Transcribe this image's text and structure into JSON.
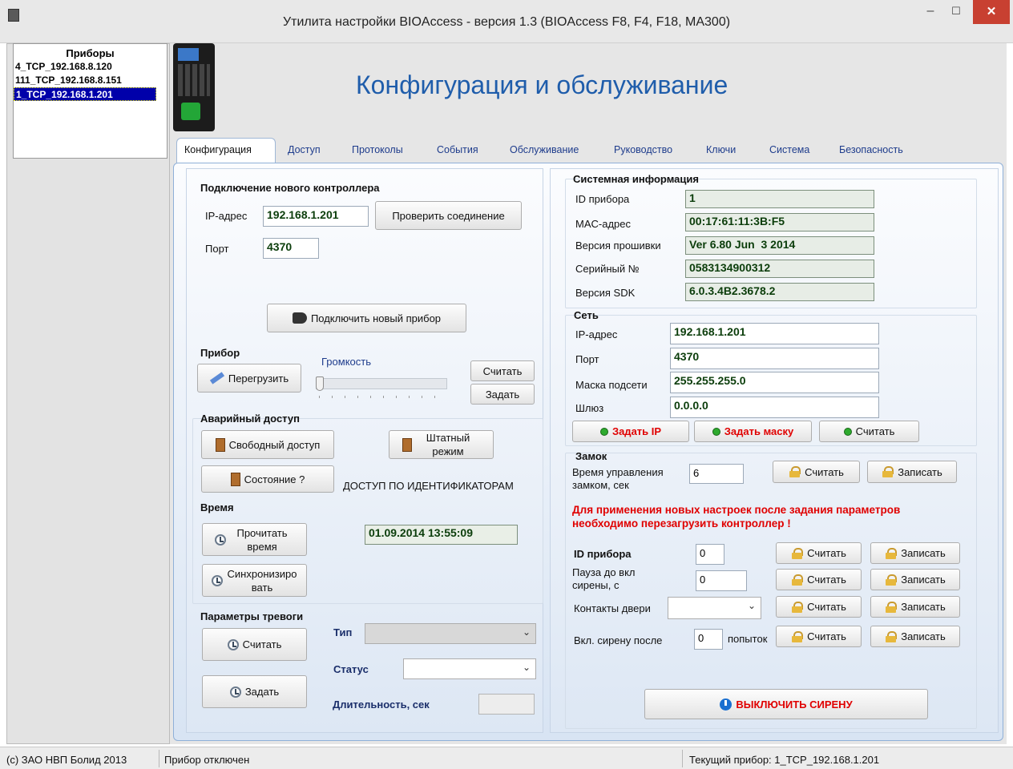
{
  "window": {
    "title": "Утилита настройки BIOAccess - версия 1.3 (BIOAccess F8, F4, F18, MA300)",
    "min": "–",
    "max": "☐",
    "close": "✕"
  },
  "devices": {
    "header": "Приборы",
    "items": [
      "4_TCP_192.168.8.120",
      "111_TCP_192.168.8.151",
      "1_TCP_192.168.1.201"
    ],
    "selected_index": 2
  },
  "heading": "Конфигурация и обслуживание",
  "tabs": [
    "Конфигурация",
    "Доступ",
    "Протоколы",
    "События",
    "Обслуживание",
    "Руководство",
    "Ключи",
    "Система",
    "Безопасность"
  ],
  "new_ctrl": {
    "title": "Подключение нового контроллера",
    "ip_label": "IP-адрес",
    "ip_value": "192.168.1.201",
    "check_btn": "Проверить соединение",
    "port_label": "Порт",
    "port_value": "4370",
    "connect_btn": "Подключить новый прибор"
  },
  "device": {
    "title": "Прибор",
    "reboot_btn": "Перегрузить",
    "volume_label": "Громкость",
    "volume_level": 0,
    "read_btn": "Считать",
    "set_btn": "Задать"
  },
  "emergency": {
    "title": "Аварийный доступ",
    "free_btn": "Свободный доступ",
    "normal_btn": "Штатный режим",
    "state_btn": "Состояние ?",
    "state_text": "ДОСТУП ПО ИДЕНТИФИКАТОРАМ"
  },
  "time": {
    "title": "Время",
    "read_btn": "Прочитать время",
    "sync_btn": "Синхронизировать",
    "value": "01.09.2014 13:55:09"
  },
  "alarm": {
    "title": "Параметры тревоги",
    "read_btn": "Считать",
    "set_btn": "Задать",
    "type_label": "Тип",
    "status_label": "Статус",
    "duration_label": "Длительность, сек"
  },
  "sysinfo": {
    "title": "Системная информация",
    "rows": [
      {
        "label": "ID прибора",
        "value": "1"
      },
      {
        "label": "MAC-адрес",
        "value": "00:17:61:11:3B:F5"
      },
      {
        "label": "Версия прошивки",
        "value": "Ver 6.80 Jun  3 2014"
      },
      {
        "label": "Серийный №",
        "value": "0583134900312"
      },
      {
        "label": "Версия SDK",
        "value": "6.0.3.4B2.3678.2"
      }
    ]
  },
  "network": {
    "title": "Сеть",
    "rows": [
      {
        "label": "IP-адрес",
        "value": "192.168.1.201"
      },
      {
        "label": "Порт",
        "value": "4370"
      },
      {
        "label": "Маска подсети",
        "value": "255.255.255.0"
      },
      {
        "label": "Шлюз",
        "value": "0.0.0.0"
      }
    ],
    "set_ip_btn": "Задать IP",
    "set_mask_btn": "Задать маску",
    "read_btn": "Считать"
  },
  "lock": {
    "title": "Замок",
    "time_label": "Время управления замком,  сек",
    "time_value": "6",
    "read_btn": "Считать",
    "write_btn": "Записать"
  },
  "warning": "Для применения новых настроек после задания параметров необходимо перезагрузить контроллер !",
  "params": {
    "id_label": "ID прибора",
    "id_value": "0",
    "pause_label": "Пауза до вкл сирены, с",
    "pause_value": "0",
    "door_label": "Контакты двери",
    "siren_label": "Вкл. сирену после",
    "siren_value": "0",
    "attempts": "попыток",
    "read_btn": "Считать",
    "write_btn": "Записать",
    "siren_off_btn": "ВЫКЛЮЧИТЬ СИРЕНУ"
  },
  "status": {
    "copyright": "(c) ЗАО НВП Болид 2013",
    "state": "Прибор отключен",
    "current": "Текущий прибор: 1_TCP_192.168.1.201"
  },
  "colors": {
    "heading": "#1f5dab",
    "accent_red": "#e00000",
    "selection": "#0000aa"
  }
}
